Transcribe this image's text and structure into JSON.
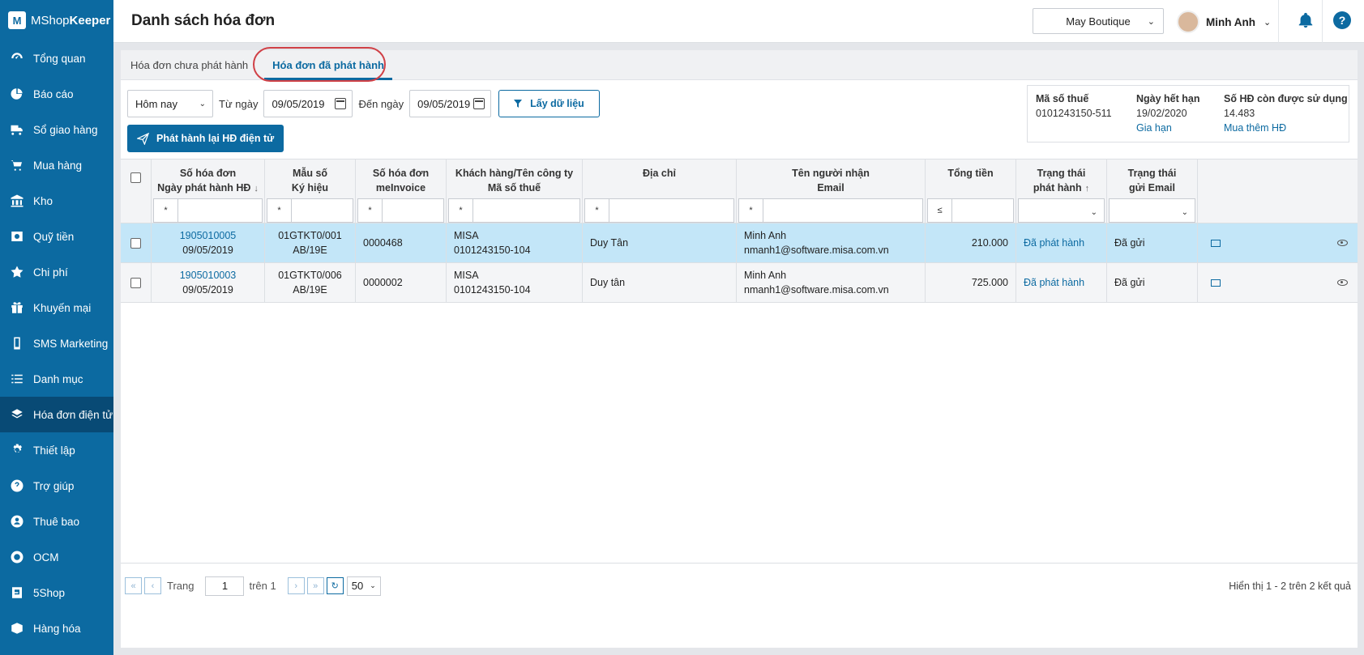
{
  "app": {
    "name_prefix": "MShop",
    "name_bold": "Keeper"
  },
  "sidebar": {
    "items": [
      {
        "label": "Tổng quan",
        "icon": "dashboard-icon"
      },
      {
        "label": "Báo cáo",
        "icon": "pie-chart-icon"
      },
      {
        "label": "Sổ giao hàng",
        "icon": "truck-icon"
      },
      {
        "label": "Mua hàng",
        "icon": "cart-icon"
      },
      {
        "label": "Kho",
        "icon": "warehouse-icon"
      },
      {
        "label": "Quỹ tiền",
        "icon": "money-icon"
      },
      {
        "label": "Chi phí",
        "icon": "expense-icon"
      },
      {
        "label": "Khuyến mại",
        "icon": "gift-icon"
      },
      {
        "label": "SMS Marketing",
        "icon": "phone-icon"
      },
      {
        "label": "Danh mục",
        "icon": "list-icon"
      },
      {
        "label": "Hóa đơn điện tử",
        "icon": "invoice-icon",
        "active": true
      },
      {
        "label": "Thiết lập",
        "icon": "gear-icon"
      },
      {
        "label": "Trợ giúp",
        "icon": "help-icon"
      },
      {
        "label": "Thuê bao",
        "icon": "user-icon"
      },
      {
        "label": "OCM",
        "icon": "ocm-icon"
      },
      {
        "label": "5Shop",
        "icon": "5shop-icon"
      },
      {
        "label": "Hàng hóa",
        "icon": "goods-icon"
      }
    ]
  },
  "header": {
    "title": "Danh sách hóa đơn",
    "store": "May Boutique",
    "user": "Minh Anh",
    "help": "?"
  },
  "tabs": [
    {
      "label": "Hóa đơn chưa phát hành"
    },
    {
      "label": "Hóa đơn đã phát hành",
      "active": true
    }
  ],
  "filters": {
    "period": "Hôm nay",
    "from_label": "Từ ngày",
    "from_date": "09/05/2019",
    "to_label": "Đến ngày",
    "to_date": "09/05/2019",
    "fetch_button": "Lấy dữ liệu",
    "reissue_button": "Phát hành lại HĐ điện tử"
  },
  "license": {
    "tax_code_label": "Mã số thuế",
    "tax_code": "0101243150-511",
    "expiry_label": "Ngày hết hạn",
    "expiry": "19/02/2020",
    "renew": "Gia hạn",
    "remaining_label": "Số HĐ còn được sử dụng",
    "remaining": "14.483",
    "buy_more": "Mua thêm HĐ"
  },
  "table": {
    "headers": {
      "invoice_no": "Số hóa đơn",
      "invoice_date": "Ngày phát hành HĐ",
      "template": "Mẫu số",
      "symbol": "Ký hiệu",
      "meinvoice_1": "Số hóa đơn",
      "meinvoice_2": "meInvoice",
      "customer_1": "Khách hàng/Tên công ty",
      "customer_2": "Mã số thuế",
      "address": "Địa chỉ",
      "recipient_1": "Tên người nhận",
      "recipient_2": "Email",
      "total": "Tổng tiền",
      "status_1": "Trạng thái",
      "status_2": "phát hành",
      "email_status_1": "Trạng thái",
      "email_status_2": "gửi Email"
    },
    "filter_ops": {
      "star": "*",
      "lte": "≤"
    },
    "rows": [
      {
        "invoice_no": "1905010005",
        "date": "09/05/2019",
        "template": "01GTKT0/001",
        "symbol": "AB/19E",
        "meinvoice": "0000468",
        "customer": "MISA",
        "tax": "0101243150-104",
        "address": "Duy Tân",
        "recipient": "Minh Anh",
        "email": "nmanh1@software.misa.com.vn",
        "total": "210.000",
        "status": "Đã phát hành",
        "email_status": "Đã gửi"
      },
      {
        "invoice_no": "1905010003",
        "date": "09/05/2019",
        "template": "01GTKT0/006",
        "symbol": "AB/19E",
        "meinvoice": "0000002",
        "customer": "MISA",
        "tax": "0101243150-104",
        "address": "Duy tân",
        "recipient": "Minh Anh",
        "email": "nmanh1@software.misa.com.vn",
        "total": "725.000",
        "status": "Đã phát hành",
        "email_status": "Đã gửi"
      }
    ]
  },
  "pager": {
    "page_label": "Trang",
    "page": "1",
    "of_label": "trên 1",
    "page_size": "50",
    "summary": "Hiển thị 1 - 2 trên 2 kết quả"
  }
}
